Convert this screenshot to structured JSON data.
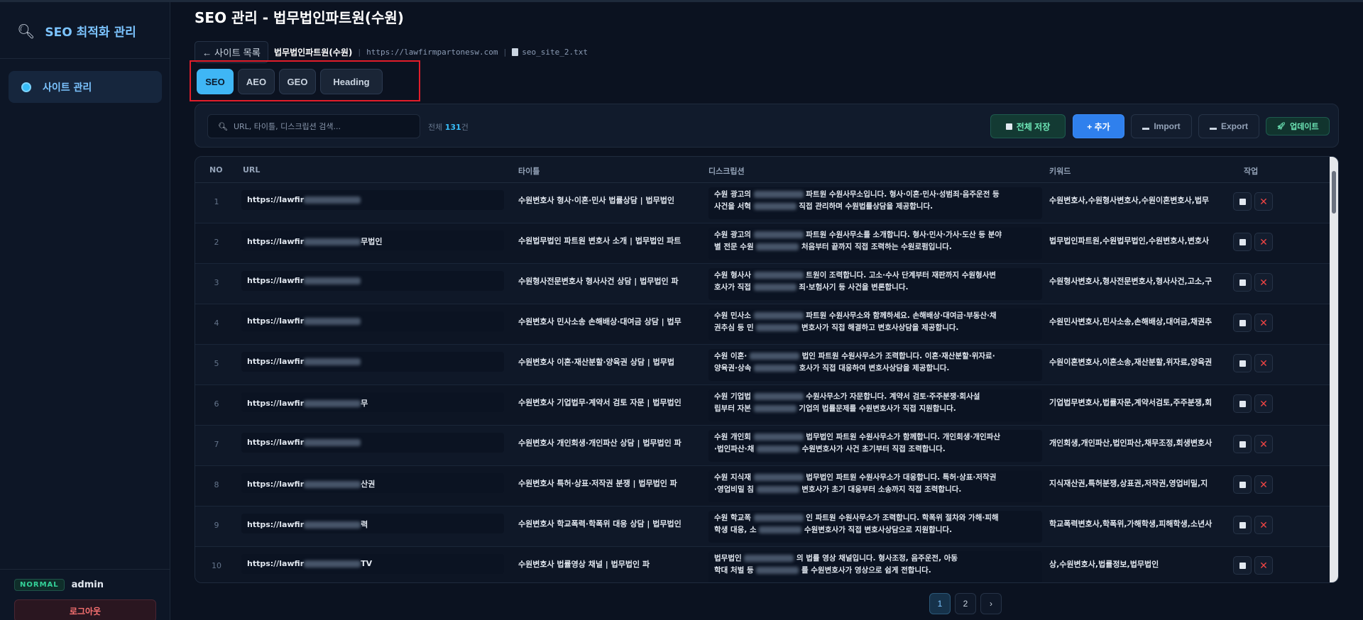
{
  "sidebar": {
    "brand_icon": "search-icon",
    "brand_title": "SEO 최적화 관리",
    "nav_item": "사이트 관리",
    "user_badge": "NORMAL",
    "user_name": "admin",
    "logout": "로그아웃"
  },
  "header": {
    "title": "SEO 관리 - 법무법인파트원(수원)",
    "back": "← 사이트 목록",
    "site_name": "법무법인파트원(수원)",
    "site_url": "https://lawfirmpartonesw.com",
    "file_name": "seo_site_2.txt"
  },
  "tabs": [
    "SEO",
    "AEO",
    "GEO",
    "Heading"
  ],
  "toolbar": {
    "search_placeholder": "URL, 타이틀, 디스크립션 검색...",
    "count_prefix": "전체 ",
    "count": "131",
    "count_suffix": "건",
    "save_all": "전체 저장",
    "add": "+ 추가",
    "import": "Import",
    "export": "Export",
    "update": "업데이트"
  },
  "columns": [
    "NO",
    "URL",
    "타이틀",
    "디스크립션",
    "키워드",
    "작업"
  ],
  "rows": [
    {
      "no": "1",
      "url": "https://lawfir",
      "url_tail": "",
      "title": "수원변호사 형사·이혼·민사 법률상담 | 법무법인",
      "desc1": "수원 광고의",
      "desc1b": "파트원 수원사무소입니다. 형사·이혼·민사·성범죄·음주운전 등",
      "desc2": "사건을 서혁",
      "desc2b": "직접 관리하며 수원법률상담을 제공합니다.",
      "kw": "수원변호사,수원형사변호사,수원이혼변호사,법무"
    },
    {
      "no": "2",
      "url": "https://lawfir",
      "url_tail": "무법인",
      "title": "수원법무법인 파트원 변호사 소개 | 법무법인 파트",
      "desc1": "수원 광고의",
      "desc1b": "파트원 수원사무소를 소개합니다. 형사·민사·가사·도산 등 분야",
      "desc2": "별 전문 수원",
      "desc2b": "처음부터 끝까지 직접 조력하는 수원로펌입니다.",
      "kw": "법무법인파트원,수원법무법인,수원변호사,변호사"
    },
    {
      "no": "3",
      "url": "https://lawfir",
      "url_tail": "",
      "title": "수원형사전문변호사 형사사건 상담 | 법무법인 파",
      "desc1": "수원 형사사",
      "desc1b": "트원이 조력합니다. 고소·수사 단계부터 재판까지 수원형사변",
      "desc2": "호사가 직접",
      "desc2b": "죄·보험사기 등 사건을 변론합니다.",
      "kw": "수원형사변호사,형사전문변호사,형사사건,고소,구"
    },
    {
      "no": "4",
      "url": "https://lawfir",
      "url_tail": "",
      "title": "수원변호사 민사소송 손해배상·대여금 상담 | 법무",
      "desc1": "수원 민사소",
      "desc1b": "파트원 수원사무소와 함께하세요. 손해배상·대여금·부동산·채",
      "desc2": "권추심 등 민",
      "desc2b": "변호사가 직접 해결하고 변호사상담을 제공합니다.",
      "kw": "수원민사변호사,민사소송,손해배상,대여금,채권추"
    },
    {
      "no": "5",
      "url": "https://lawfir",
      "url_tail": "",
      "title": "수원변호사 이혼·재산분할·양육권 상담 | 법무법",
      "desc1": "수원 이혼·",
      "desc1b": "법인 파트원 수원사무소가 조력합니다. 이혼·재산분할·위자료·",
      "desc2": "양육권·상속",
      "desc2b": "호사가 직접 대응하여 변호사상담을 제공합니다.",
      "kw": "수원이혼변호사,이혼소송,재산분할,위자료,양육권"
    },
    {
      "no": "6",
      "url": "https://lawfir",
      "url_tail": "무",
      "title": "수원변호사 기업법무·계약서 검토 자문 | 법무법인",
      "desc1": "수원 기업법",
      "desc1b": "수원사무소가 자문합니다. 계약서 검토·주주분쟁·회사설",
      "desc2": "립부터 자본",
      "desc2b": "기업의 법률문제를 수원변호사가 직접 지원합니다.",
      "kw": "기업법무변호사,법률자문,계약서검토,주주분쟁,회"
    },
    {
      "no": "7",
      "url": "https://lawfir",
      "url_tail": "",
      "title": "수원변호사 개인회생·개인파산 상담 | 법무법인 파",
      "desc1": "수원 개인회",
      "desc1b": "법무법인 파트원 수원사무소가 함께합니다. 개인회생·개인파산",
      "desc2": "·법인파산·채",
      "desc2b": "수원변호사가 사건 초기부터 직접 조력합니다.",
      "kw": "개인회생,개인파산,법인파산,채무조정,회생변호사"
    },
    {
      "no": "8",
      "url": "https://lawfir",
      "url_tail": "산권",
      "title": "수원변호사 특허·상표·저작권 분쟁 | 법무법인 파",
      "desc1": "수원 지식재",
      "desc1b": "법무법인 파트원 수원사무소가 대응합니다. 특허·상표·저작권",
      "desc2": "·영업비밀 침",
      "desc2b": "변호사가 초기 대응부터 소송까지 직접 조력합니다.",
      "kw": "지식재산권,특허분쟁,상표권,저작권,영업비밀,지"
    },
    {
      "no": "9",
      "url": "https://lawfir",
      "url_tail": "력",
      "title": "수원변호사 학교폭력·학폭위 대응 상담 | 법무법인",
      "desc1": "수원 학교폭",
      "desc1b": "인 파트원 수원사무소가 조력합니다. 학폭위 절차와 가해·피해",
      "desc2": "학생 대응, 소",
      "desc2b": "수원변호사가 직접 변호사상담으로 지원합니다.",
      "kw": "학교폭력변호사,학폭위,가해학생,피해학생,소년사"
    },
    {
      "no": "10",
      "url": "https://lawfir",
      "url_tail": "TV",
      "title": "수원변호사 법률영상 채널 | 법무법인 파",
      "desc1": "법무법인",
      "desc1b": "의 법률 영상 채널입니다. 형사조정, 음주운전, 아동",
      "desc2": "학대 처벌 등",
      "desc2b": "를 수원변호사가 영상으로 쉽게 전합니다.",
      "kw": "상,수원변호사,법률정보,법무법인"
    }
  ],
  "pagination": [
    "1",
    "2",
    "›"
  ]
}
